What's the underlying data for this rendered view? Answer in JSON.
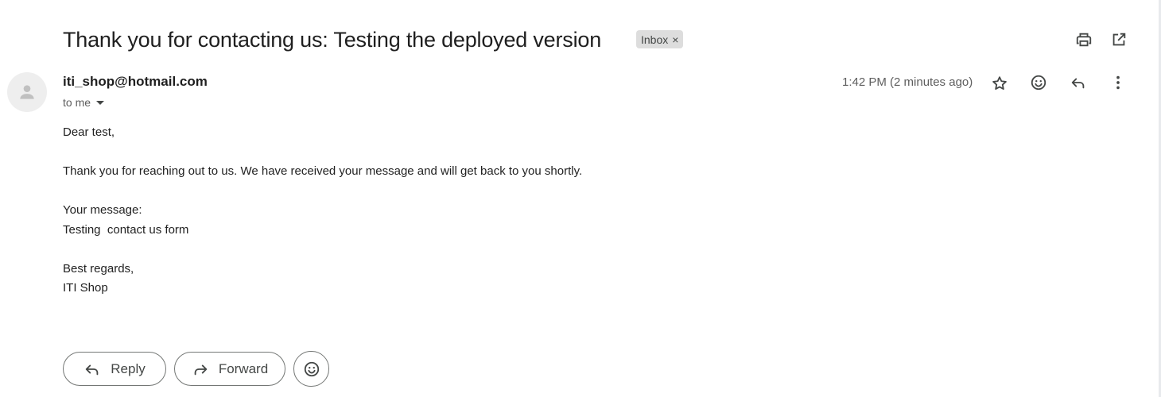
{
  "header": {
    "subject": "Thank you for contacting us: Testing the deployed version",
    "label": "Inbox",
    "label_close": "×",
    "print_icon": "print-icon",
    "open_new_window_icon": "open-in-new-window-icon"
  },
  "message": {
    "avatar_icon": "person-icon",
    "sender": "iti_shop@hotmail.com",
    "recipient": "to me",
    "time": "1:42 PM (2 minutes ago)",
    "actions": [
      "star-icon",
      "emoji-icon",
      "reply-icon",
      "more-vert-icon"
    ],
    "body": [
      "Dear test,",
      "",
      "Thank you for reaching out to us. We have received your message and will get back to you shortly.",
      "",
      "Your message:",
      "Testing  contact us form",
      "",
      "Best regards,",
      "ITI Shop"
    ]
  },
  "footer": {
    "reply_label": "Reply",
    "forward_label": "Forward",
    "emoji_icon": "emoji-icon"
  },
  "colors": {
    "text": "#1f1f1f",
    "secondary_text": "#5e5e5e",
    "chip_background": "#dddddd",
    "button_border": "#747775"
  }
}
